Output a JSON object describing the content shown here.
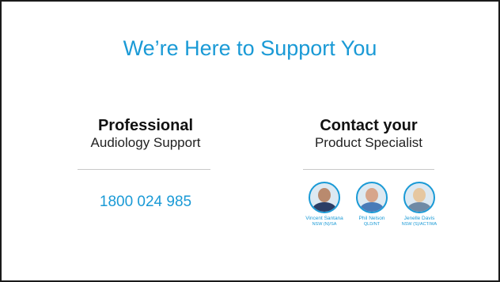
{
  "title": "We’re Here to Support You",
  "left": {
    "heading": "Professional",
    "subheading": "Audiology Support",
    "phone": "1800 024 985"
  },
  "right": {
    "heading": "Contact your",
    "subheading": "Product Specialist",
    "people": [
      {
        "name": "Vincent Santana",
        "region": "NSW (N)/SA"
      },
      {
        "name": "Phil Nelson",
        "region": "QLD/NT"
      },
      {
        "name": "Jenelle Davis",
        "region": "NSW (S)/ACT/WA"
      }
    ]
  },
  "colors": {
    "accent": "#1a9ad6",
    "border": "#1a1a1a",
    "divider": "#c9c9c9"
  }
}
